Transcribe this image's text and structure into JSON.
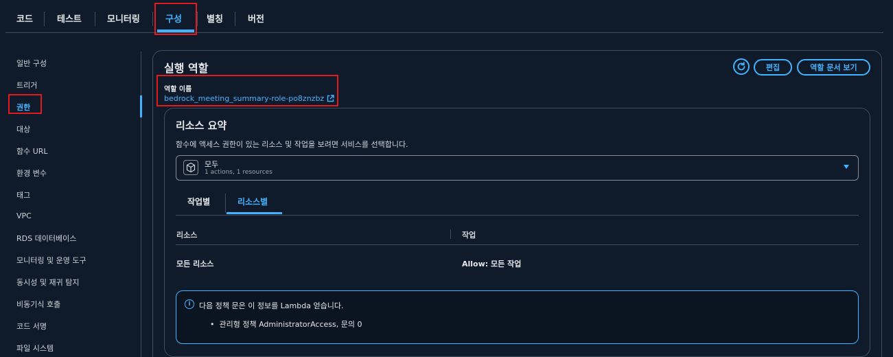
{
  "top_tabs": [
    "코드",
    "테스트",
    "모니터링",
    "구성",
    "별칭",
    "버전"
  ],
  "top_active": "구성",
  "sidebar": {
    "items": [
      "일반 구성",
      "트리거",
      "권한",
      "대상",
      "함수 URL",
      "환경 변수",
      "태그",
      "VPC",
      "RDS 데이터베이스",
      "모니터링 및 운영 도구",
      "동시성 및 재귀 탐지",
      "비동기식 호출",
      "코드 서명",
      "파일 시스템"
    ],
    "active": "권한"
  },
  "role_section": {
    "title": "실행 역할",
    "edit_label": "편집",
    "view_doc_label": "역할 문서 보기",
    "role_name_label": "역할 이름",
    "role_name": "bedrock_meeting_summary-role-po8znzbz"
  },
  "resource_summary": {
    "title": "리소스 요약",
    "description": "함수에 액세스 권한이 있는 리소스 및 작업을 보려면 서비스를 선택합니다.",
    "select_value": "모두",
    "select_sub": "1 actions, 1 resources",
    "tabs": [
      "작업별",
      "리소스별"
    ],
    "active_tab": "리소스별",
    "table": {
      "headers": [
        "리소스",
        "작업"
      ],
      "rows": [
        [
          "모든 리소스",
          "Allow: 모든 작업"
        ]
      ]
    },
    "info_text": "다음 정책 문은 이 정보를 Lambda 얻습니다.",
    "info_bullet": "관리형 정책 AdministratorAccess, 문의 0"
  },
  "colors": {
    "accent": "#42b4ff",
    "background": "#0f1b2a",
    "highlight_box": "#e31b1b"
  }
}
